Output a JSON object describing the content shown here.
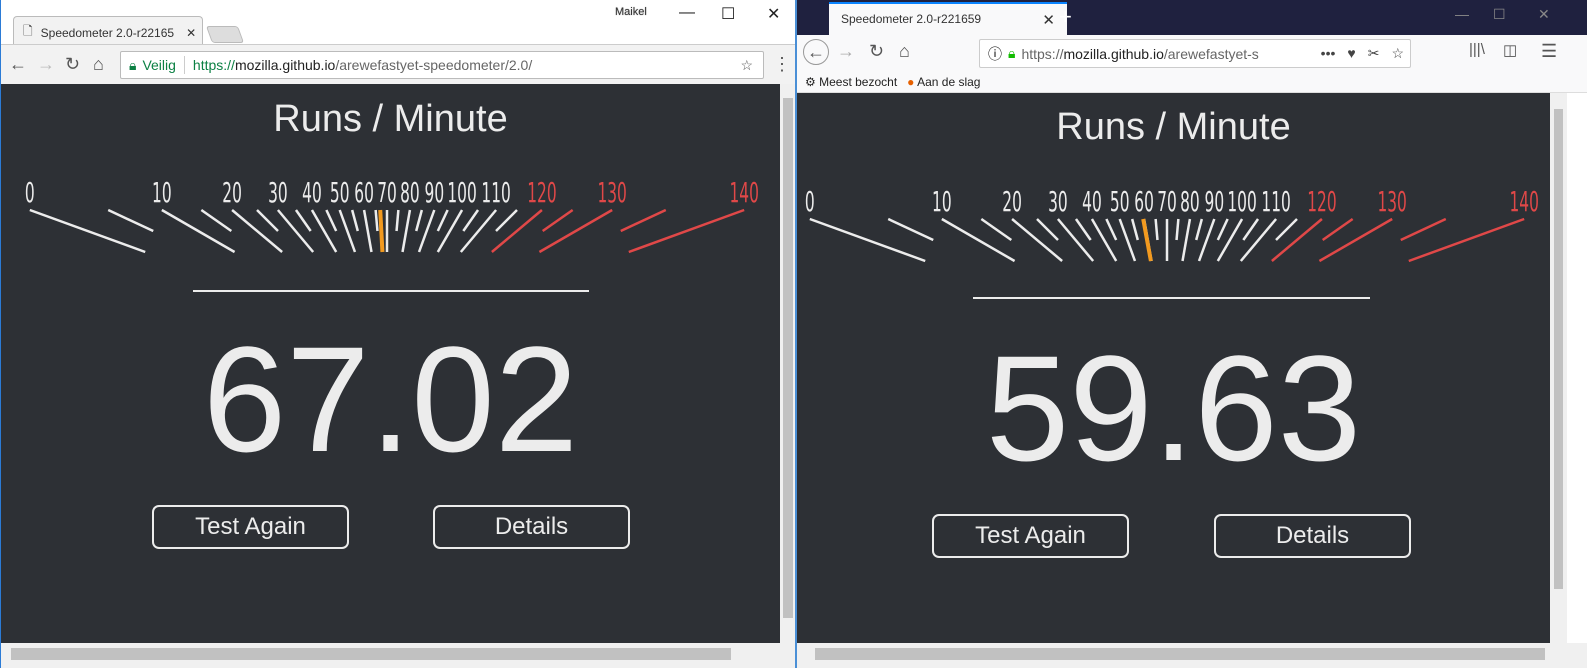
{
  "chrome_window": {
    "tab_title": "Speedometer 2.0-r22165",
    "user": "Maikel",
    "security_label": "Veilig",
    "url_scheme": "https://",
    "url_host": "mozilla.github.io",
    "url_path": "/arewefastyet-speedometer/2.0/",
    "page": {
      "heading": "Runs / Minute",
      "score": "67.02",
      "test_again": "Test Again",
      "details": "Details"
    }
  },
  "firefox_window": {
    "tab_title": "Speedometer 2.0-r221659",
    "url_scheme": "https://",
    "url_host": "mozilla.github.io",
    "url_path": "/arewefastyet-s",
    "bookmarks": [
      "Meest bezocht",
      "Aan de slag"
    ],
    "page": {
      "heading": "Runs / Minute",
      "score": "59.63",
      "test_again": "Test Again",
      "details": "Details"
    }
  },
  "chart_data": [
    {
      "type": "gauge",
      "title": "Runs / Minute",
      "tick_labels": [
        "0",
        "10",
        "20",
        "30",
        "40",
        "50",
        "60",
        "70",
        "80",
        "90",
        "100",
        "110",
        "120",
        "130",
        "140"
      ],
      "range": [
        0,
        140
      ],
      "minor_step": 5,
      "red_from": 120,
      "needle_value": 67.02
    },
    {
      "type": "gauge",
      "title": "Runs / Minute",
      "tick_labels": [
        "0",
        "10",
        "20",
        "30",
        "40",
        "50",
        "60",
        "70",
        "80",
        "90",
        "100",
        "110",
        "120",
        "130",
        "140"
      ],
      "range": [
        0,
        140
      ],
      "minor_step": 5,
      "red_from": 120,
      "needle_value": 59.63
    }
  ],
  "colors": {
    "background": "#2d3035",
    "text": "#ececec",
    "red": "#e04848",
    "needle": "#f29a1f"
  }
}
